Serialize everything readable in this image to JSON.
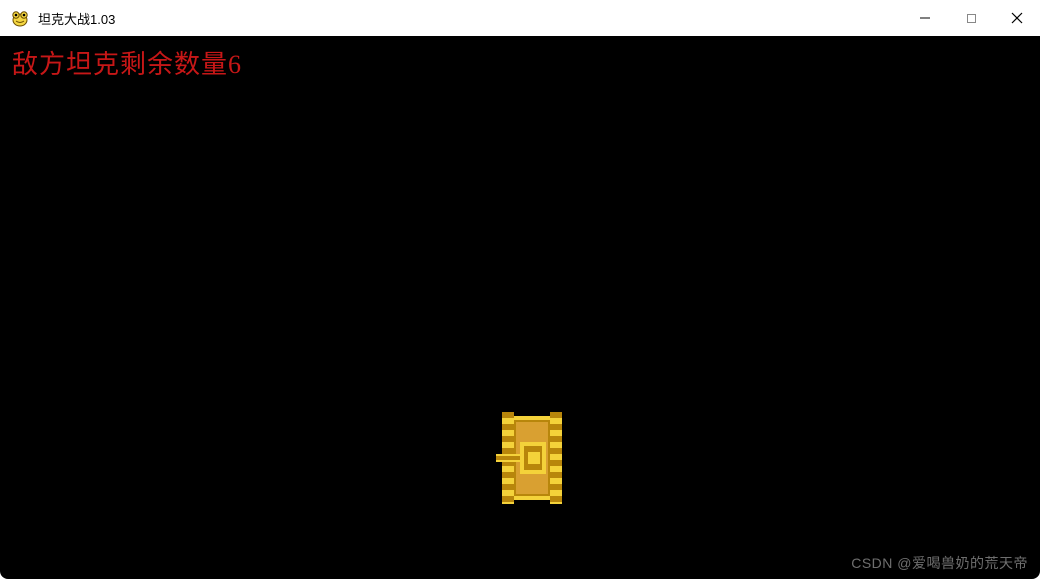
{
  "window": {
    "title": "坦克大战1.03"
  },
  "hud": {
    "enemy_remaining_text": "敌方坦克剩余数量6"
  },
  "colors": {
    "hud_text": "#c71717",
    "tank_primary": "#f4d23a",
    "tank_secondary": "#b8860b",
    "game_bg": "#000000"
  },
  "watermark": "CSDN @爱喝兽奶的荒天帝"
}
